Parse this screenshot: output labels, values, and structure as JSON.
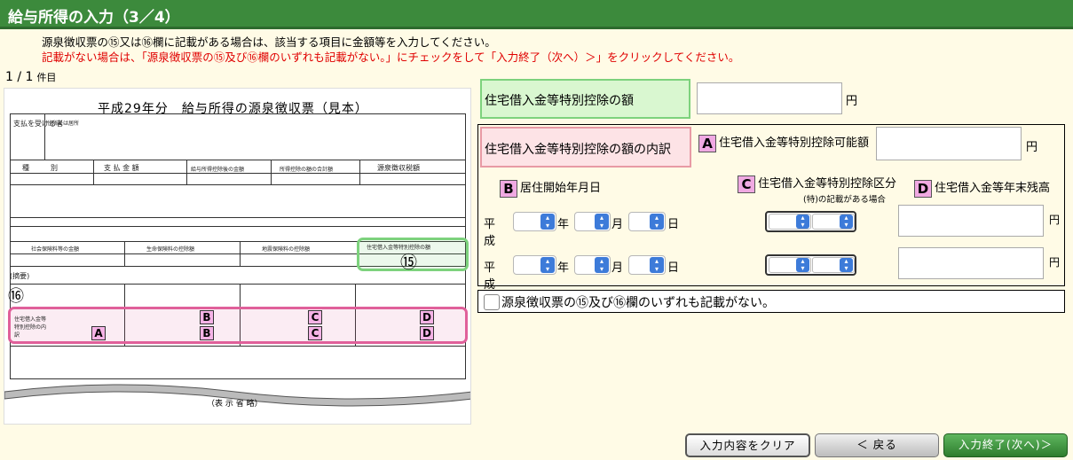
{
  "page": {
    "title": "給与所得の入力（3／4）",
    "instruction1": "源泉徴収票の⑮又は⑯欄に記載がある場合は、該当する項目に金額等を入力してください。",
    "instruction2": "記載がない場合は、「源泉徴収票の⑮及び⑯欄のいずれも記載がない。」にチェックをして「入力終了（次へ）＞」をクリックしてください。",
    "count": "1 / 1",
    "count_unit": "件目"
  },
  "sample": {
    "title": "平成29年分　給与所得の源泉徴収票（見本）",
    "circle15": "⑮",
    "circle16": "⑯",
    "field15_label": "住宅借入金等特別控除の額",
    "summary_label": "(摘要)",
    "omit": "（表 示 省 略）",
    "labels": {
      "shiharai": "支払を受ける者",
      "jusho": "住所又は居所",
      "shubetsu": "種　　　別",
      "shiharai_kingaku": "支 払 金 額",
      "kyuyo_kojo": "給与所得控除後の金額",
      "shotoku_kojo": "所得控除の額の合計額",
      "gensen": "源泉徴収税額",
      "shakai": "社会保険料等の金額",
      "seimei": "生命保険料の控除額",
      "jishin": "地震保険料の控除額",
      "juutaku": "住宅借入金等特別控除の内訳"
    }
  },
  "form": {
    "field15": {
      "label": "住宅借入金等特別控除の額",
      "value": "",
      "unit": "円"
    },
    "field16": {
      "label": "住宅借入金等特別控除の額の内訳"
    },
    "A": {
      "mark": "A",
      "label": "住宅借入金等特別控除可能額",
      "value": "",
      "unit": "円"
    },
    "B": {
      "mark": "B",
      "label": "居住開始年月日"
    },
    "C": {
      "mark": "C",
      "label": "住宅借入金等特別控除区分",
      "note": "(特)の記載がある場合"
    },
    "D": {
      "mark": "D",
      "label": "住宅借入金等年末残高"
    },
    "era": "平成",
    "year_unit": "年",
    "month_unit": "月",
    "day_unit": "日",
    "yen": "円",
    "none_checkbox_label": "源泉徴収票の⑮及び⑯欄のいずれも記載がない。"
  },
  "buttons": {
    "clear": "入力内容をクリア",
    "back": "＜ 戻る",
    "next": "入力終了(次へ)＞"
  },
  "colors": {
    "title_bar": "#3c8a3c",
    "highlight15": "#7dd27d",
    "highlight16": "#e0609a",
    "marker": "#f0a9e2",
    "warning_text": "#e00000"
  }
}
